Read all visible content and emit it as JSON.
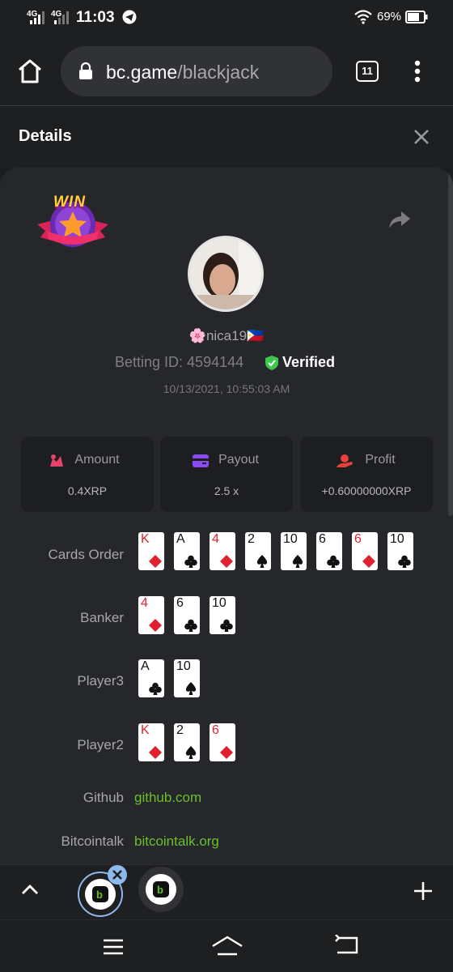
{
  "status_bar": {
    "time": "11:03",
    "net1": "4G",
    "net2": "4G",
    "battery": "69%"
  },
  "browser": {
    "url_host": "bc.game",
    "url_path": "/blackjack",
    "tab_count": "11"
  },
  "details": {
    "title": "Details",
    "badge_text": "WIN",
    "username": "🌸nica19🇵🇭",
    "betting_id_label": "Betting ID: 4594144",
    "verified": "Verified",
    "timestamp": "10/13/2021, 10:55:03 AM",
    "stats": [
      {
        "label": "Amount",
        "value": "0.4XRP",
        "icon": "amount-icon",
        "color": "#e8416a"
      },
      {
        "label": "Payout",
        "value": "2.5 x",
        "icon": "wallet-icon",
        "color": "#8a4cf0"
      },
      {
        "label": "Profit",
        "value": "+0.60000000XRP",
        "icon": "profit-icon",
        "color": "#e8403a"
      }
    ],
    "rows": {
      "cards_order": {
        "label": "Cards Order",
        "cards": [
          {
            "rank": "K",
            "suit": "diamond"
          },
          {
            "rank": "A",
            "suit": "club"
          },
          {
            "rank": "4",
            "suit": "diamond"
          },
          {
            "rank": "2",
            "suit": "spade"
          },
          {
            "rank": "10",
            "suit": "spade"
          },
          {
            "rank": "6",
            "suit": "club"
          },
          {
            "rank": "6",
            "suit": "diamond"
          },
          {
            "rank": "10",
            "suit": "club"
          }
        ]
      },
      "banker": {
        "label": "Banker",
        "cards": [
          {
            "rank": "4",
            "suit": "diamond"
          },
          {
            "rank": "6",
            "suit": "club"
          },
          {
            "rank": "10",
            "suit": "club"
          }
        ]
      },
      "player3": {
        "label": "Player3",
        "cards": [
          {
            "rank": "A",
            "suit": "club"
          },
          {
            "rank": "10",
            "suit": "spade"
          }
        ]
      },
      "player2": {
        "label": "Player2",
        "cards": [
          {
            "rank": "K",
            "suit": "diamond"
          },
          {
            "rank": "2",
            "suit": "spade"
          },
          {
            "rank": "6",
            "suit": "diamond"
          }
        ]
      }
    },
    "links": {
      "github_label": "Github",
      "github_value": "github.com",
      "bitcointalk_label": "Bitcointalk",
      "bitcointalk_value": "bitcointalk.org"
    }
  },
  "colors": {
    "accent_green": "#6cbf2d",
    "verified_green": "#3ac84a",
    "background": "#1b1c1f",
    "panel": "#26272b"
  }
}
